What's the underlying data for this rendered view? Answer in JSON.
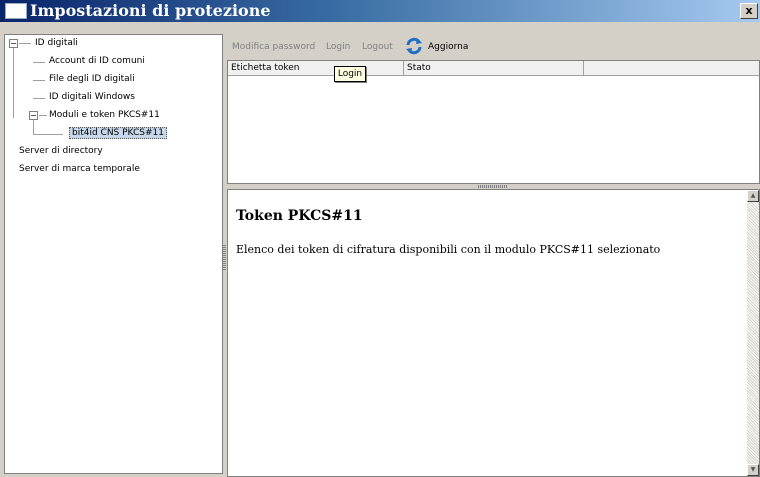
{
  "window": {
    "title": "Impostazioni di protezione",
    "close_label": "x"
  },
  "tree": {
    "items": [
      {
        "label": "ID digitali"
      },
      {
        "label": "Account di ID comuni"
      },
      {
        "label": "File degli ID digitali"
      },
      {
        "label": "ID digitali Windows"
      },
      {
        "label": "Moduli e token PKCS#11"
      },
      {
        "label": "bit4id CNS PKCS#11"
      },
      {
        "label": "Server di directory"
      },
      {
        "label": "Server di marca temporale"
      }
    ],
    "expander_symbol": "−"
  },
  "toolbar": {
    "change_password_label": "Modifica password",
    "login_label": "Login",
    "logout_label": "Logout",
    "refresh_label": "Aggiorna",
    "refresh_icon": "refresh-icon"
  },
  "table": {
    "columns": [
      "Etichetta token",
      "Stato"
    ]
  },
  "tooltip": {
    "text": "Login"
  },
  "description": {
    "title": "Token PKCS#11",
    "body": "Elenco dei token di cifratura disponibili con il modulo PKCS#11 selezionato"
  },
  "scrollbar": {
    "up_arrow": "▲",
    "down_arrow": "▼"
  },
  "colors": {
    "title_bar": "#0a246a",
    "background": "#d4d0c8",
    "selected": "#c7d7ea",
    "tooltip_bg": "#ffffe1"
  }
}
